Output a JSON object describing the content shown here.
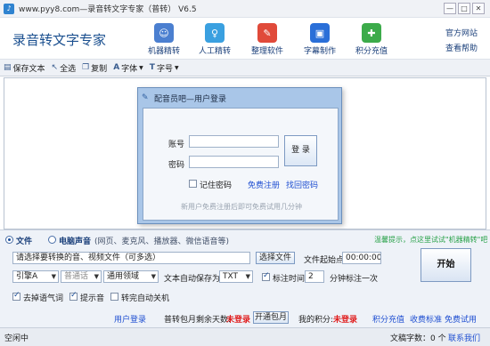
{
  "window": {
    "title": "www.pyy8.com—录音转文字专家（普转） V6.5",
    "minimize": "—",
    "maximize": "□",
    "close": "✕"
  },
  "header": {
    "app_name": "录音转文字专家",
    "nav": [
      {
        "label": "机器精转",
        "icon": "robot-icon",
        "color": "#4b7fd0",
        "glyph": "☺"
      },
      {
        "label": "人工精转",
        "icon": "person-icon",
        "color": "#3aa0e0",
        "glyph": "♀"
      },
      {
        "label": "整理软件",
        "icon": "edit-pen-icon",
        "color": "#e04a3a",
        "glyph": "✎"
      },
      {
        "label": "字幕制作",
        "icon": "subtitle-icon",
        "color": "#2a6fd8",
        "glyph": "▣"
      },
      {
        "label": "积分充值",
        "icon": "coins-icon",
        "color": "#3cab4a",
        "glyph": "✚"
      }
    ],
    "official_site": "官方网站",
    "help": "查看帮助"
  },
  "toolbar": [
    {
      "label": "保存文本",
      "icon": "save-icon",
      "glyph": "▤"
    },
    {
      "label": "全选",
      "icon": "cursor-icon",
      "glyph": "↖"
    },
    {
      "label": "复制",
      "icon": "copy-icon",
      "glyph": "❐"
    },
    {
      "label": "字体",
      "icon": "font-icon",
      "glyph": "A"
    },
    {
      "label": "字号",
      "icon": "font-size-icon",
      "glyph": "T"
    }
  ],
  "dialog": {
    "title": "配音员吧—用户登录",
    "account_label": "账号",
    "password_label": "密码",
    "login_button": "登 录",
    "remember_label": "记住密码",
    "register_link": "免费注册",
    "recover_link": "找回密码",
    "hint": "新用户免费注册后即可免费试用几分钟"
  },
  "panel": {
    "source_file": "文件",
    "source_pc": "电脑声音",
    "source_pc_note": "(网页、麦克风、播放器、微信语音等)",
    "notice": "温馨提示，点这里试试\"机器精转\"吧",
    "file_placeholder": "请选择要转换的音、视频文件（可多选）",
    "choose_file": "选择文件",
    "start_label": "文件起始点",
    "start_time": "00:00:00",
    "start_button": "开始",
    "engine": "引擎A",
    "language": "普通话",
    "domain": "通用领域",
    "autosave_label": "文本自动保存为",
    "autosave_format": "TXT",
    "mark_time_label": "标注时间",
    "mark_interval": "2",
    "mark_suffix": "分钟标注一次",
    "remove_filler": "去掉语气词",
    "beep": "提示音",
    "auto_shutdown": "转完自动关机",
    "user_login": "用户登录",
    "monthly_left_label": "普转包月剩余天数:",
    "not_logged_1": "未登录",
    "open_monthly": "开通包月",
    "points_label": "我的积分:",
    "not_logged_2": "未登录",
    "recharge": "积分充值",
    "pricing": "收费标准",
    "free_trial": "免费试用"
  },
  "status": {
    "left": "空闲中",
    "count_label": "文稿字数：0 个",
    "contact": "联系我们"
  }
}
